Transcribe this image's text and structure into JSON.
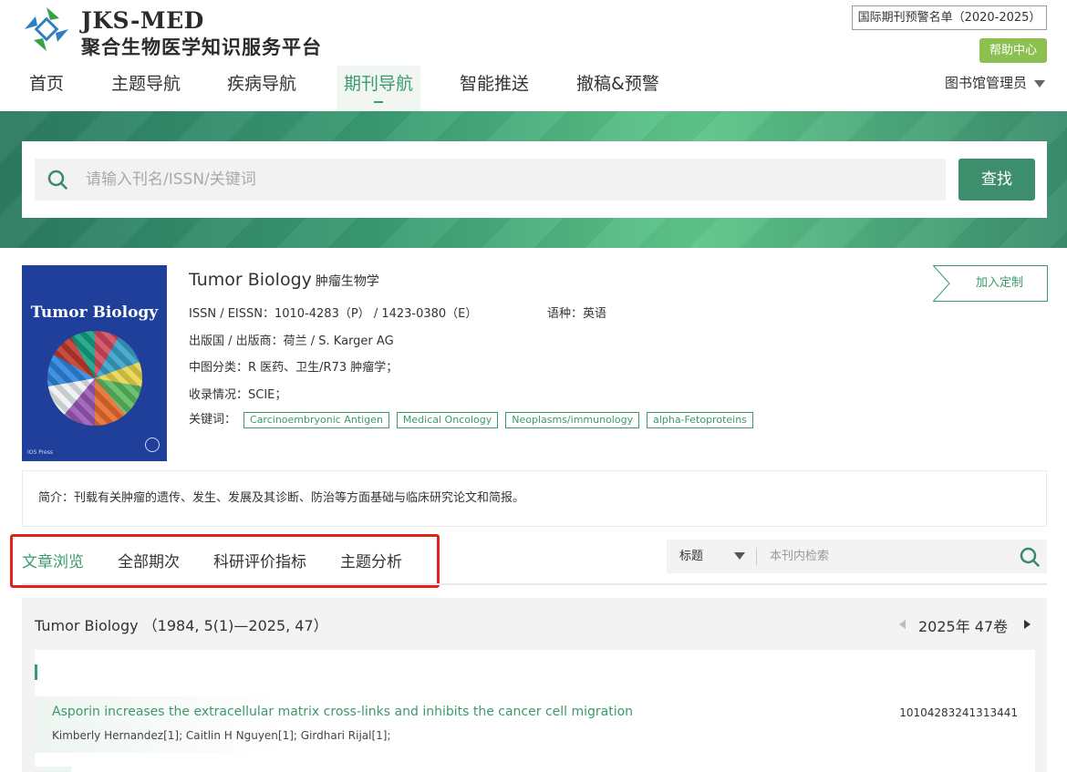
{
  "header": {
    "logo_en": "JKS-MED",
    "logo_cn": "聚合生物医学知识服务平台",
    "warning_list": "国际期刊预警名单（2020-2025）",
    "help_label": "帮助中心",
    "user_label": "图书馆管理员"
  },
  "nav": {
    "items": [
      {
        "label": "首页"
      },
      {
        "label": "主题导航"
      },
      {
        "label": "疾病导航"
      },
      {
        "label": "期刊导航"
      },
      {
        "label": "智能推送"
      },
      {
        "label": "撤稿&预警"
      }
    ],
    "active": "期刊导航"
  },
  "search": {
    "placeholder": "请输入刊名/ISSN/关键词",
    "button_label": "查找"
  },
  "journal": {
    "cover_title": "Tumor Biology",
    "cover_publisher": "IOS Press",
    "title_en": "Tumor Biology",
    "title_cn": "肿瘤生物学",
    "issn": "ISSN / EISSN：1010-4283（P） / 1423-0380（E）",
    "language": "语种：英语",
    "publisher": "出版国 / 出版商：荷兰 / S. Karger AG",
    "classification": "中图分类：R 医药、卫生/R73 肿瘤学；",
    "indexed": "收录情况：SCIE；",
    "keywords_label": "关键词：",
    "keywords": [
      "Carcinoembryonic Antigen",
      "Medical Oncology",
      "Neoplasms/immunology",
      "alpha-Fetoproteins"
    ],
    "customize_label": "加入定制",
    "intro": "简介：刊载有关肿瘤的遗传、发生、发展及其诊断、防治等方面基础与临床研究论文和简报。"
  },
  "tabs": {
    "items": [
      {
        "label": "文章浏览"
      },
      {
        "label": "全部期次"
      },
      {
        "label": "科研评价指标"
      },
      {
        "label": "主题分析"
      }
    ],
    "active": "文章浏览"
  },
  "inner_search": {
    "field": "标题",
    "placeholder": "本刊内检索"
  },
  "listing": {
    "range": "Tumor Biology （1984, 5(1)—2025, 47）",
    "volume": "2025年 47卷",
    "articles": [
      {
        "title": "Asporin increases the extracellular matrix cross-links and inhibits the cancer cell migration",
        "authors": "Kimberly Hernandez[1]; Caitlin H Nguyen[1]; Girdhari Rijal[1];",
        "id": "10104283241313441"
      }
    ]
  },
  "colors": {
    "accent": "#3a9a6c",
    "help_green": "#8cc152",
    "highlight_red": "#e0231b"
  }
}
